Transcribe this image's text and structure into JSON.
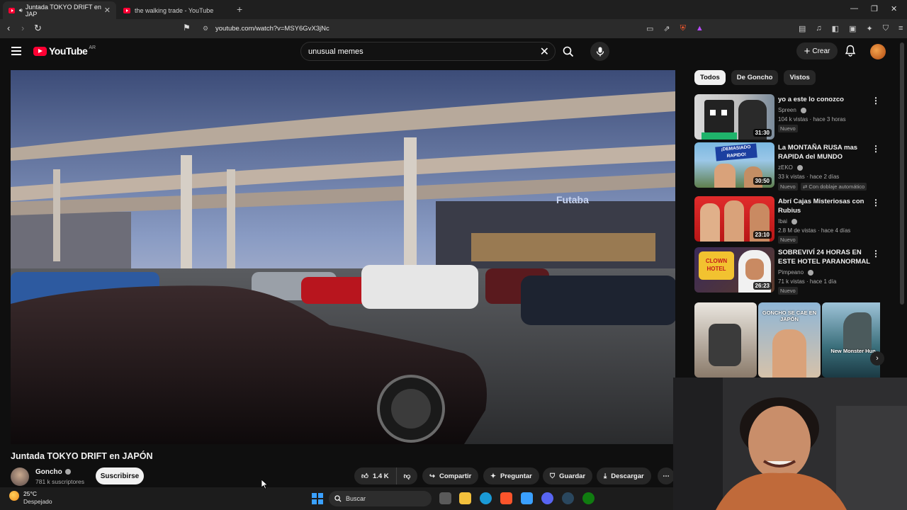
{
  "browser": {
    "tabs": [
      {
        "label": "Juntada TOKYO DRIFT en JAP",
        "active": true
      },
      {
        "label": "the walking trade - YouTube",
        "active": false
      }
    ],
    "url": "youtube.com/watch?v=MSY6GvX3jNc"
  },
  "header": {
    "logo_text": "YouTube",
    "region": "AR",
    "search_value": "unusual memes",
    "create_label": "Crear"
  },
  "video": {
    "title": "Juntada TOKYO DRIFT en JAPÓN",
    "channel": "Goncho",
    "subscribers": "781 k suscriptores",
    "subscribe_label": "Suscribirse",
    "likes": "1.4 K",
    "share_label": "Compartir",
    "ask_label": "Preguntar",
    "save_label": "Guardar",
    "download_label": "Descargar",
    "overlay_sign": "Futaba"
  },
  "chips": [
    "Todos",
    "De Goncho",
    "Vistos"
  ],
  "recommendations": [
    {
      "title": "yo a este lo conozco",
      "channel": "Spreen",
      "stats": "104 k vistas · hace 3 horas",
      "badge": "Nuevo",
      "duration": "31:30",
      "thumb_text": ""
    },
    {
      "title": "La MONTAÑA RUSA mas RAPIDA del MUNDO",
      "channel": "zEKO",
      "stats": "33 k vistas · hace 2 días",
      "badge": "Nuevo",
      "dub": "Con doblaje automático",
      "duration": "30:50",
      "thumb_text": "¡DEMASIADO RAPIDO!"
    },
    {
      "title": "Abrí Cajas Misteriosas con Rubius",
      "channel": "Ibai",
      "stats": "2.8 M de vistas · hace 4 días",
      "badge": "Nuevo",
      "duration": "23:10",
      "thumb_text": ""
    },
    {
      "title": "SOBREVIVÍ 24 HORAS EN ESTE HOTEL PARANORMAL",
      "channel": "Pimpeano",
      "stats": "71 k vistas · hace 1 día",
      "badge": "Nuevo",
      "duration": "26:23",
      "thumb_text": "CLOWN HOTEL"
    }
  ],
  "shorts": [
    {
      "caption": ""
    },
    {
      "caption": "GONCHO SE CAE EN JAPÓN"
    },
    {
      "caption": "New Monster Hun"
    }
  ],
  "taskbar": {
    "temperature": "25°C",
    "weather": "Despejado",
    "search_placeholder": "Buscar"
  }
}
